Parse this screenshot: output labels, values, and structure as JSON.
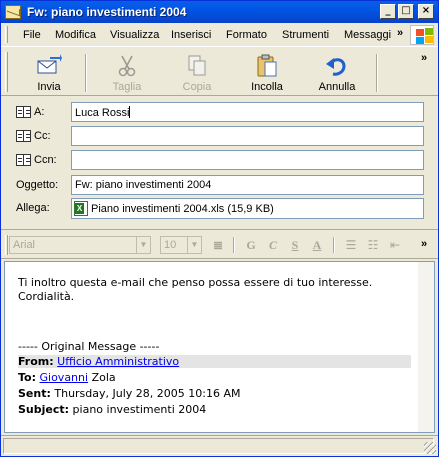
{
  "window": {
    "title": "Fw: piano investimenti 2004"
  },
  "menu": [
    {
      "label": "File",
      "accel": "F"
    },
    {
      "label": "Modifica",
      "accel": "M"
    },
    {
      "label": "Visualizza",
      "accel": "V"
    },
    {
      "label": "Inserisci",
      "accel": "I"
    },
    {
      "label": "Formato",
      "accel": "o"
    },
    {
      "label": "Strumenti",
      "accel": "S"
    },
    {
      "label": "Messaggi",
      "accel": "a"
    }
  ],
  "toolbar": {
    "send": "Invia",
    "cut": "Taglia",
    "copy": "Copia",
    "paste": "Incolla",
    "undo": "Annulla"
  },
  "fields": {
    "to_label": "A:",
    "to_value": "Luca Rossi",
    "cc_label": "Cc:",
    "cc_value": "",
    "bcc_label": "Ccn:",
    "bcc_value": "",
    "subject_label": "Oggetto:",
    "subject_value": "Fw: piano investimenti 2004",
    "attach_label": "Allega:",
    "attach_value": "Piano investimenti 2004.xls (15,9 KB)"
  },
  "format_toolbar": {
    "font": "Arial",
    "size": "10"
  },
  "message": {
    "line1": "Ti inoltro questa e-mail che penso possa essere di tuo interesse.",
    "line2": "Cordialità.",
    "separator": "----- Original Message -----",
    "from_label": "From:",
    "from_value": "Ufficio Amministrativo",
    "to_label": "To:",
    "to_link": "Giovanni",
    "to_rest": "Zola",
    "sent_label": "Sent:",
    "sent_value": "Thursday, July 28, 2005 10:16 AM",
    "subject_label": "Subject:",
    "subject_value": "piano investimenti 2004"
  }
}
